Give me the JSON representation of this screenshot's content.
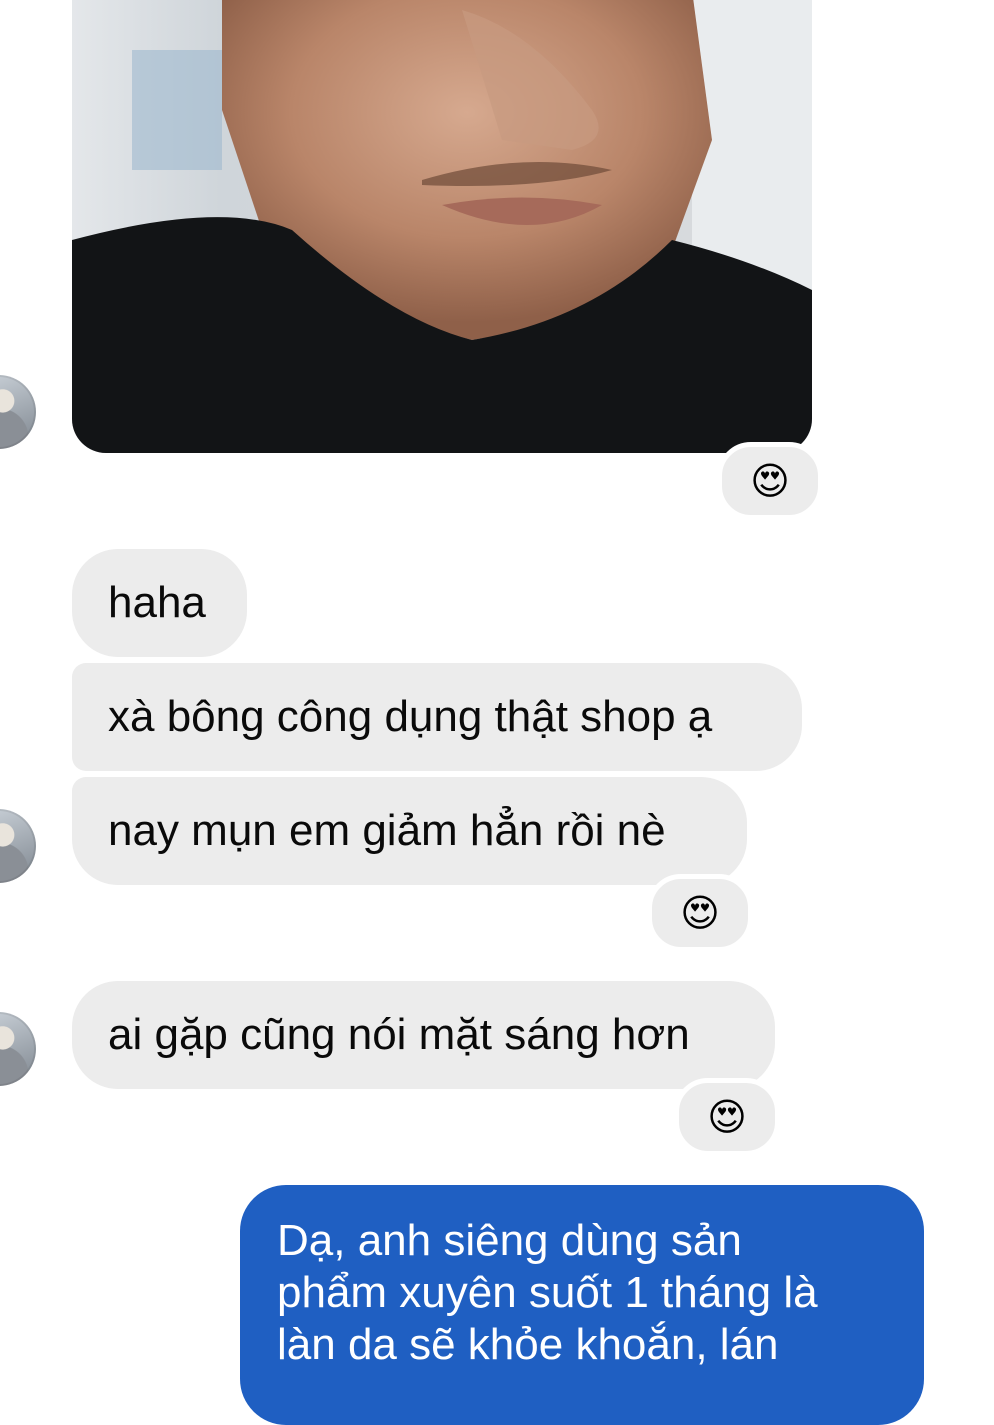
{
  "conversation": {
    "photo": {
      "alt": "photo-message"
    },
    "incoming": [
      {
        "text": "haha"
      },
      {
        "text": "xà bông công dụng thật shop ạ"
      },
      {
        "text": "nay mụn em giảm hẳn rồi nè"
      },
      {
        "text": "ai gặp cũng nói mặt sáng hơn"
      }
    ],
    "reaction_emoji": "😍",
    "outgoing": {
      "lines": [
        "Dạ, anh siêng dùng sản",
        "phẩm xuyên suốt 1 tháng là",
        "làn da sẽ khỏe khoắn, lán"
      ]
    }
  },
  "colors": {
    "incoming_bubble": "#ececec",
    "outgoing_bubble": "#1f5fc2",
    "background": "#ffffff"
  }
}
